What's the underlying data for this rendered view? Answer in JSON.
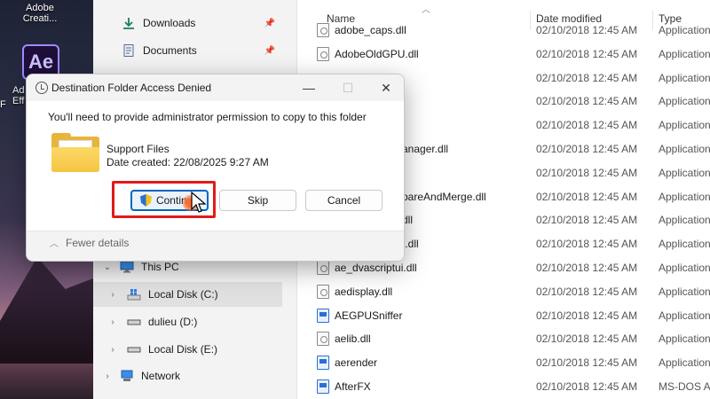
{
  "desktop": {
    "icon1_label": "Adobe\nCreati...",
    "icon2_glyph": "Ae",
    "icon2_label_partial": "Ad\nEff",
    "edge_f": "F"
  },
  "nav": {
    "items": [
      {
        "label": "Downloads",
        "icon": "download-icon",
        "pinned": true
      },
      {
        "label": "Documents",
        "icon": "document-icon",
        "pinned": true
      },
      {
        "label": "This PC",
        "icon": "computer-icon"
      },
      {
        "label": "Local Disk (C:)",
        "icon": "drive-icon"
      },
      {
        "label": "dulieu (D:)",
        "icon": "drive-icon"
      },
      {
        "label": "Local Disk (E:)",
        "icon": "drive-icon"
      },
      {
        "label": "Network",
        "icon": "network-icon"
      }
    ]
  },
  "files": {
    "columns": {
      "name": "Name",
      "date": "Date modified",
      "type": "Type"
    },
    "rows": [
      {
        "name": "adobe_caps.dll",
        "date": "02/10/2018 12:45 AM",
        "type": "Application"
      },
      {
        "name": "AdobeOldGPU.dll",
        "date": "02/10/2018 12:45 AM",
        "type": "Application"
      },
      {
        "name": "",
        "date": "02/10/2018 12:45 AM",
        "type": "Application"
      },
      {
        "name": "",
        "date": "02/10/2018 12:45 AM",
        "type": "Application"
      },
      {
        "name": "",
        "date": "02/10/2018 12:45 AM",
        "type": "Application"
      },
      {
        "name": "anager.dll",
        "date": "02/10/2018 12:45 AM",
        "type": "Application"
      },
      {
        "name": "",
        "date": "02/10/2018 12:45 AM",
        "type": "Application"
      },
      {
        "name": "pareAndMerge.dll",
        "date": "02/10/2018 12:45 AM",
        "type": "Application"
      },
      {
        "name": "dll",
        "date": "02/10/2018 12:45 AM",
        "type": "Application"
      },
      {
        "name": "t.dll",
        "date": "02/10/2018 12:45 AM",
        "type": "Application"
      },
      {
        "name": "ae_dvascriptui.dll",
        "date": "02/10/2018 12:45 AM",
        "type": "Application"
      },
      {
        "name": "aedisplay.dll",
        "date": "02/10/2018 12:45 AM",
        "type": "Application"
      },
      {
        "name": "AEGPUSniffer",
        "date": "02/10/2018 12:45 AM",
        "type": "Application"
      },
      {
        "name": "aelib.dll",
        "date": "02/10/2018 12:45 AM",
        "type": "Application"
      },
      {
        "name": "aerender",
        "date": "02/10/2018 12:45 AM",
        "type": "Application"
      },
      {
        "name": "AfterFX",
        "date": "02/10/2018 12:45 AM",
        "type": "MS-DOS Ap"
      }
    ]
  },
  "dialog": {
    "title": "Destination Folder Access Denied",
    "message": "You'll need to provide administrator permission to copy to this folder",
    "item_name": "Support Files",
    "item_date": "Date created: 22/08/2025 9:27 AM",
    "continue_label": "Continue",
    "skip_label": "Skip",
    "cancel_label": "Cancel",
    "fewer_details": "Fewer details",
    "minimize": "—",
    "maximize": "☐",
    "close": "✕"
  },
  "colors": {
    "highlight": "#e01b1b",
    "accent": "#0067c0"
  }
}
